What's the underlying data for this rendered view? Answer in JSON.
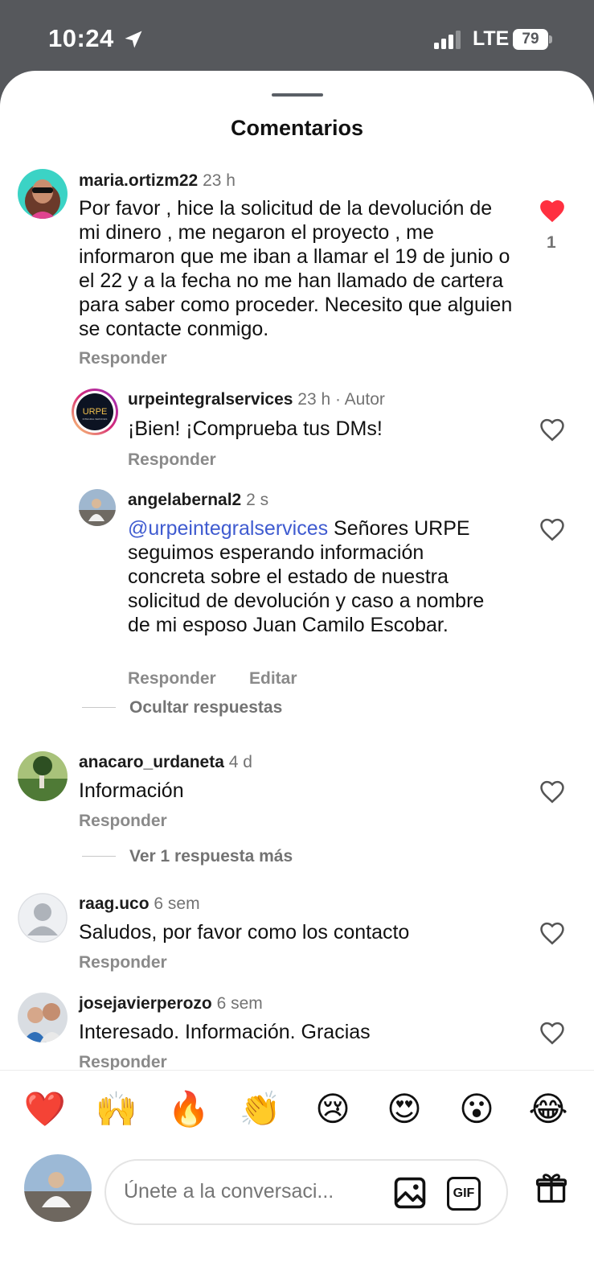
{
  "status_bar": {
    "time": "10:24",
    "network": "LTE",
    "battery": "79"
  },
  "header": {
    "title": "Comentarios"
  },
  "comments": [
    {
      "username": "maria.ortizm22",
      "time": "23 h",
      "text": "Por favor , hice la solicitud de la devolución de mi dinero , me negaron el proyecto , me informaron que me iban a llamar el 19 de junio o el 22 y a la fecha no me han llamado de cartera para saber como proceder. Necesito  que alguien se contacte conmigo.",
      "reply_label": "Responder",
      "likes": "1",
      "liked": true
    },
    {
      "username": "urpeintegralservices",
      "time": "23 h",
      "author_badge": "· Autor",
      "text": "¡Bien! ¡Comprueba tus DMs!",
      "reply_label": "Responder",
      "avatar_text": "URPE",
      "avatar_subtext": "INTEGRAL SERVICES"
    },
    {
      "username": "angelabernal2",
      "time": "2 s",
      "mention": "@urpeintegralservices",
      "text": " Señores URPE seguimos esperando información concreta sobre el estado de nuestra solicitud de devolución y caso a nombre de mi esposo Juan Camilo Escobar.",
      "reply_label": "Responder",
      "edit_label": "Editar"
    },
    {
      "username": "anacaro_urdaneta",
      "time": "4 d",
      "text": "Información",
      "reply_label": "Responder"
    },
    {
      "username": "raag.uco",
      "time": "6 sem",
      "text": "Saludos, por favor como los contacto",
      "reply_label": "Responder"
    },
    {
      "username": "josejavierperozo",
      "time": "6 sem",
      "text": "Interesado. Información. Gracias",
      "reply_label": "Responder"
    }
  ],
  "threads": {
    "hide_replies": "Ocultar respuestas",
    "more_replies": "Ver 1 respuesta más"
  },
  "emoji_bar": [
    "❤️",
    "🙌",
    "🔥",
    "👏",
    "😢",
    "😍",
    "😮",
    "😂"
  ],
  "composer": {
    "placeholder": "Únete a la conversaci...",
    "gif_label": "GIF"
  },
  "colors": {
    "like_red": "#ff3040",
    "mention_blue": "#3f5bd0",
    "muted_gray": "#737373"
  }
}
